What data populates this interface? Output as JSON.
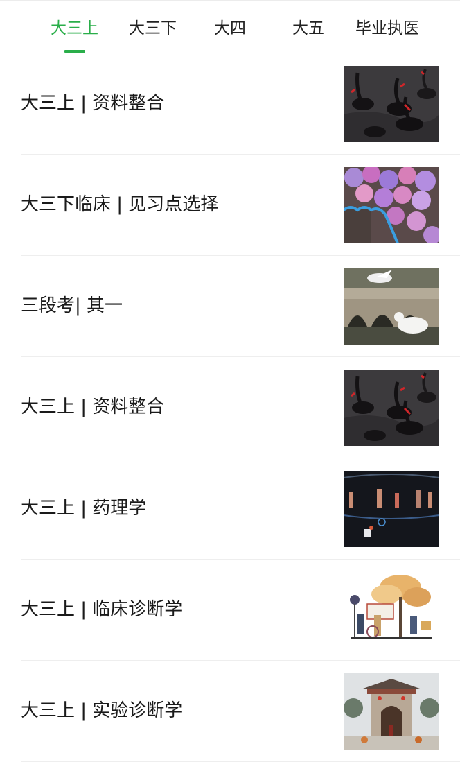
{
  "tabs": [
    {
      "label": "大三上",
      "active": true
    },
    {
      "label": "大三下",
      "active": false
    },
    {
      "label": "大四",
      "active": false
    },
    {
      "label": "大五",
      "active": false
    },
    {
      "label": "毕业执医",
      "active": false
    }
  ],
  "accent_color": "#2aae4a",
  "articles": [
    {
      "title": "大三上 | 资料整合",
      "thumbnail": "black-swans-image"
    },
    {
      "title": "大三下临床 | 见习点选择",
      "thumbnail": "hydrangea-flowers-image"
    },
    {
      "title": "三段考| 其一",
      "thumbnail": "stone-bridge-pigeons-image"
    },
    {
      "title": "大三上 | 资料整合",
      "thumbnail": "black-swans-image"
    },
    {
      "title": "大三上 | 药理学",
      "thumbnail": "stage-performance-image"
    },
    {
      "title": "大三上 | 临床诊断学",
      "thumbnail": "illustrated-tree-characters-image"
    },
    {
      "title": "大三上 | 实验诊断学",
      "thumbnail": "winter-gate-image"
    }
  ]
}
